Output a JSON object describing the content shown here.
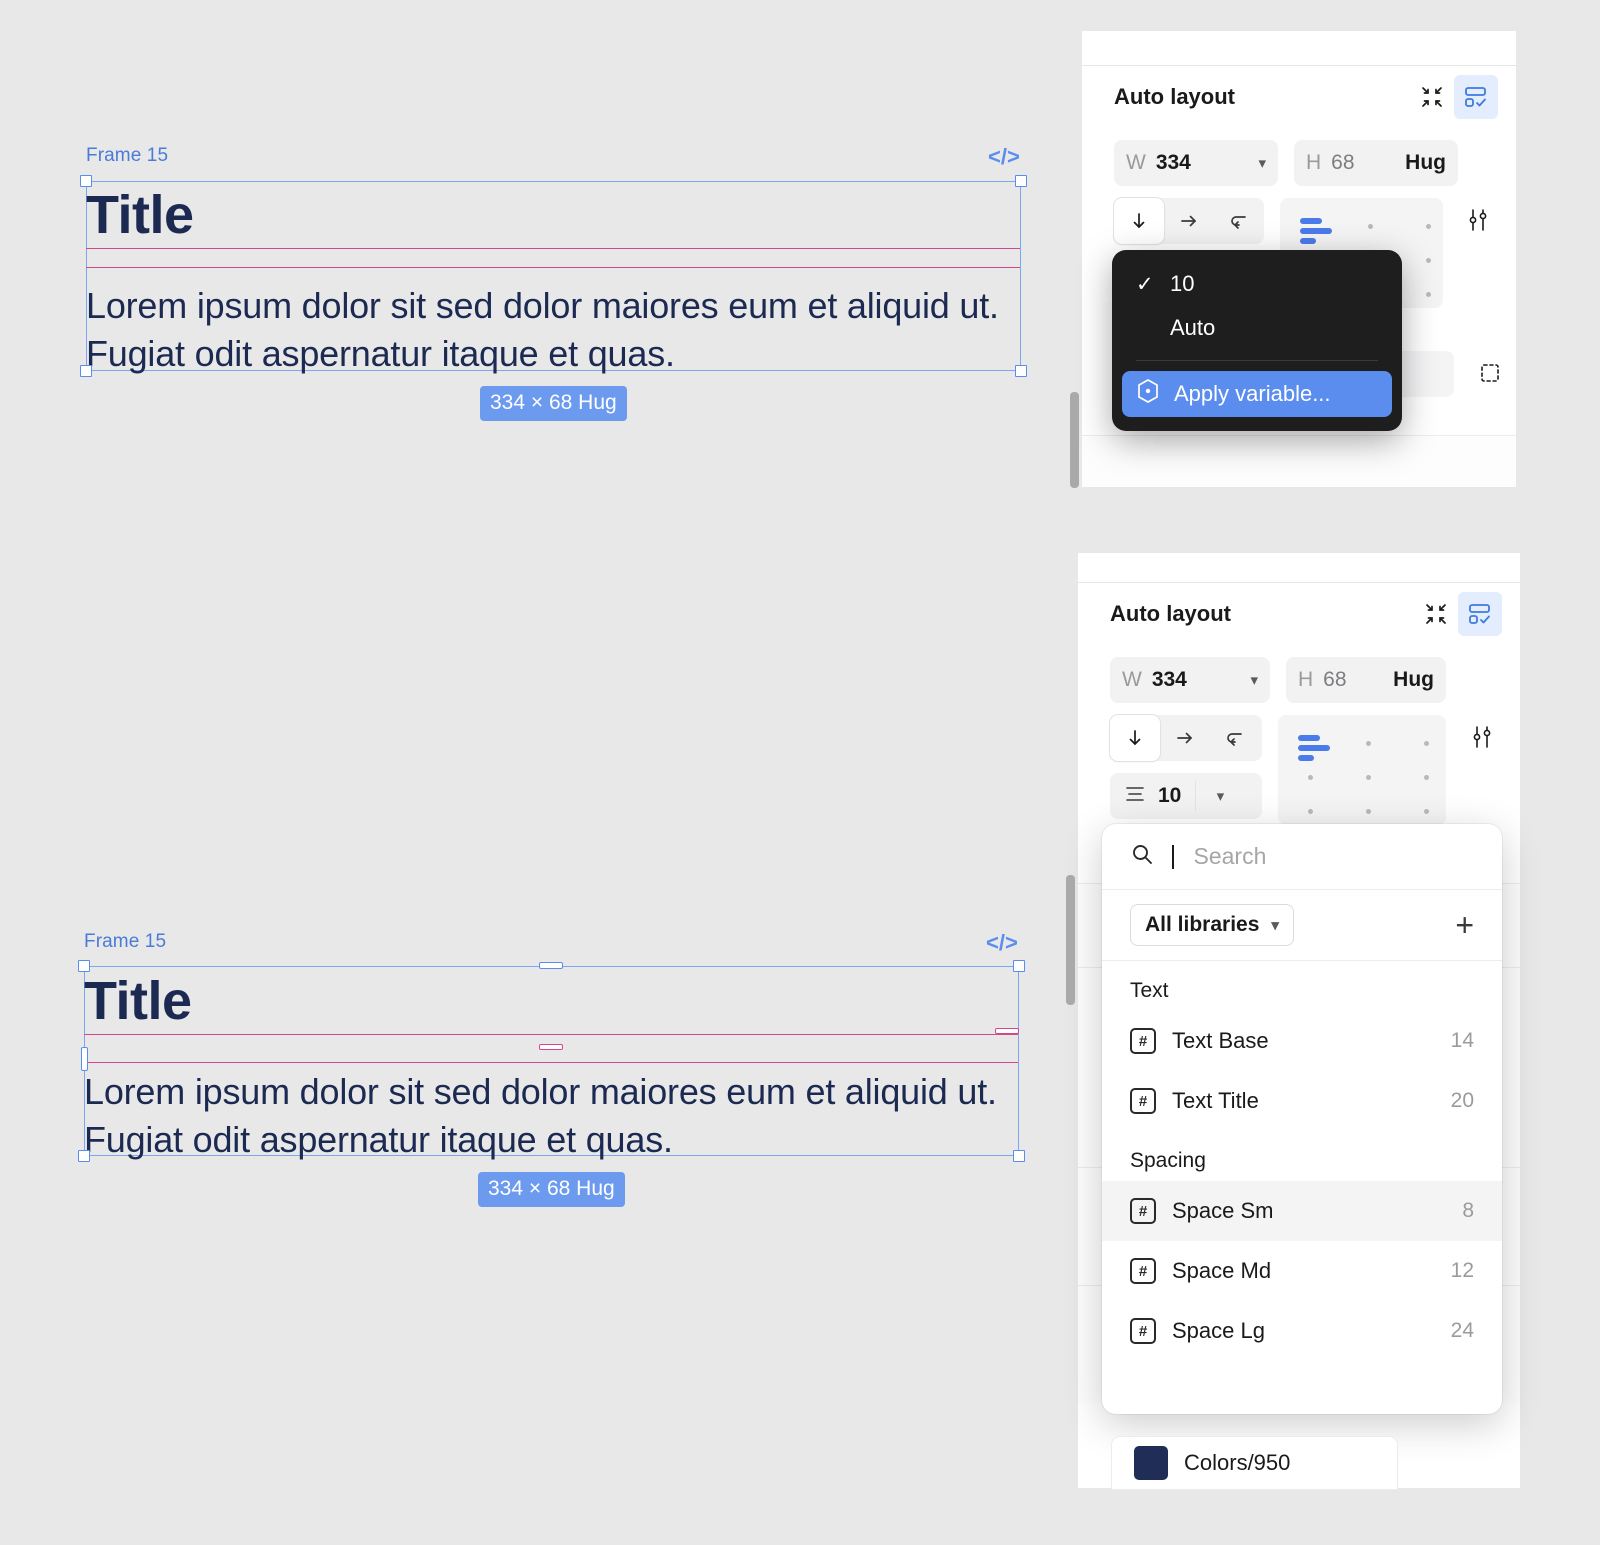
{
  "canvas": {
    "frames": [
      {
        "label": "Frame 15",
        "title": "Title",
        "body": "Lorem ipsum dolor sit sed dolor maiores eum et aliquid ut. Fugiat odit aspernatur itaque et quas.",
        "size_badge": "334 × 68 Hug",
        "code_icon": "</>"
      },
      {
        "label": "Frame 15",
        "title": "Title",
        "body": "Lorem ipsum dolor sit sed dolor maiores eum et aliquid ut. Fugiat odit aspernatur itaque et quas.",
        "size_badge": "334 × 68 Hug",
        "code_icon": "</>"
      }
    ],
    "colors": {
      "selection": "#5b8def",
      "spacing_guide": "#d6468f",
      "text": "#1c2a52",
      "background": "#e8e8e8"
    }
  },
  "panel_top": {
    "section_title": "Auto layout",
    "width_label": "W",
    "width_value": "334",
    "height_label": "H",
    "height_value": "68",
    "height_mode": "Hug",
    "direction_icons": [
      "arrow-down",
      "arrow-right",
      "wrap"
    ],
    "dropdown": {
      "items": [
        {
          "label": "10",
          "checked": true
        },
        {
          "label": "Auto",
          "checked": false
        }
      ],
      "apply_variable_label": "Apply variable..."
    }
  },
  "panel_bottom": {
    "section_title": "Auto layout",
    "width_label": "W",
    "width_value": "334",
    "height_label": "H",
    "height_value": "68",
    "height_mode": "Hug",
    "gap_value": "10",
    "picker": {
      "search_placeholder": "Search",
      "library_filter": "All libraries",
      "add_label": "+",
      "groups": [
        {
          "name": "Text",
          "items": [
            {
              "name": "Text Base",
              "value": "14",
              "highlighted": false
            },
            {
              "name": "Text Title",
              "value": "20",
              "highlighted": false
            }
          ]
        },
        {
          "name": "Spacing",
          "items": [
            {
              "name": "Space Sm",
              "value": "8",
              "highlighted": true
            },
            {
              "name": "Space Md",
              "value": "12",
              "highlighted": false
            },
            {
              "name": "Space Lg",
              "value": "24",
              "highlighted": false
            }
          ]
        }
      ]
    },
    "color_row": {
      "name": "Colors/950",
      "swatch": "#1f2d57"
    }
  }
}
